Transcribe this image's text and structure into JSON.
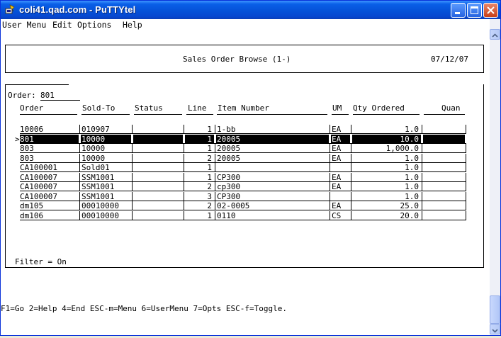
{
  "window": {
    "title": "coli41.qad.com - PuTTYtel",
    "accent": "#0552d8"
  },
  "menubar": {
    "items": [
      "User Menu",
      "Edit",
      "Options",
      "Help"
    ]
  },
  "header": {
    "title": "Sales Order Browse (1-)",
    "date": "07/12/07"
  },
  "browse": {
    "order_label": "Order:",
    "order_value": "801",
    "columns": [
      "Order",
      "Sold-To",
      "Status",
      "Line",
      "Item Number",
      "UM",
      "Qty Ordered",
      "Quan"
    ],
    "rows": [
      {
        "order": "10006",
        "sold_to": "010907",
        "status": "",
        "line": "1",
        "item": "1-bb",
        "um": "EA",
        "qty": "1.0",
        "selected": false
      },
      {
        "order": "801",
        "sold_to": "10000",
        "status": "",
        "line": "1",
        "item": "20005",
        "um": "EA",
        "qty": "10.0",
        "selected": true
      },
      {
        "order": "803",
        "sold_to": "10000",
        "status": "",
        "line": "1",
        "item": "20005",
        "um": "EA",
        "qty": "1,000.0",
        "selected": false
      },
      {
        "order": "803",
        "sold_to": "10000",
        "status": "",
        "line": "2",
        "item": "20005",
        "um": "EA",
        "qty": "1.0",
        "selected": false
      },
      {
        "order": "CA100001",
        "sold_to": "Sold01",
        "status": "",
        "line": "1",
        "item": "",
        "um": "",
        "qty": "1.0",
        "selected": false
      },
      {
        "order": "CA100007",
        "sold_to": "SSM1001",
        "status": "",
        "line": "1",
        "item": "CP300",
        "um": "EA",
        "qty": "1.0",
        "selected": false
      },
      {
        "order": "CA100007",
        "sold_to": "SSM1001",
        "status": "",
        "line": "2",
        "item": "cp300",
        "um": "EA",
        "qty": "1.0",
        "selected": false
      },
      {
        "order": "CA100007",
        "sold_to": "SSM1001",
        "status": "",
        "line": "3",
        "item": "CP300",
        "um": "",
        "qty": "1.0",
        "selected": false
      },
      {
        "order": "dm105",
        "sold_to": "00010000",
        "status": "",
        "line": "2",
        "item": "02-0005",
        "um": "EA",
        "qty": "25.0",
        "selected": false
      },
      {
        "order": "dm106",
        "sold_to": "00010000",
        "status": "",
        "line": "1",
        "item": "0110",
        "um": "CS",
        "qty": "20.0",
        "selected": false
      }
    ],
    "selected_marker": ">",
    "filter_text": "Filter = On"
  },
  "footer": {
    "keys": "F1=Go 2=Help 4=End ESC-m=Menu 6=UserMenu 7=Opts ESC-f=Toggle."
  },
  "icons": {
    "app": "putty-icon",
    "minimize": "minimize-icon",
    "maximize": "maximize-icon",
    "close": "close-icon"
  }
}
